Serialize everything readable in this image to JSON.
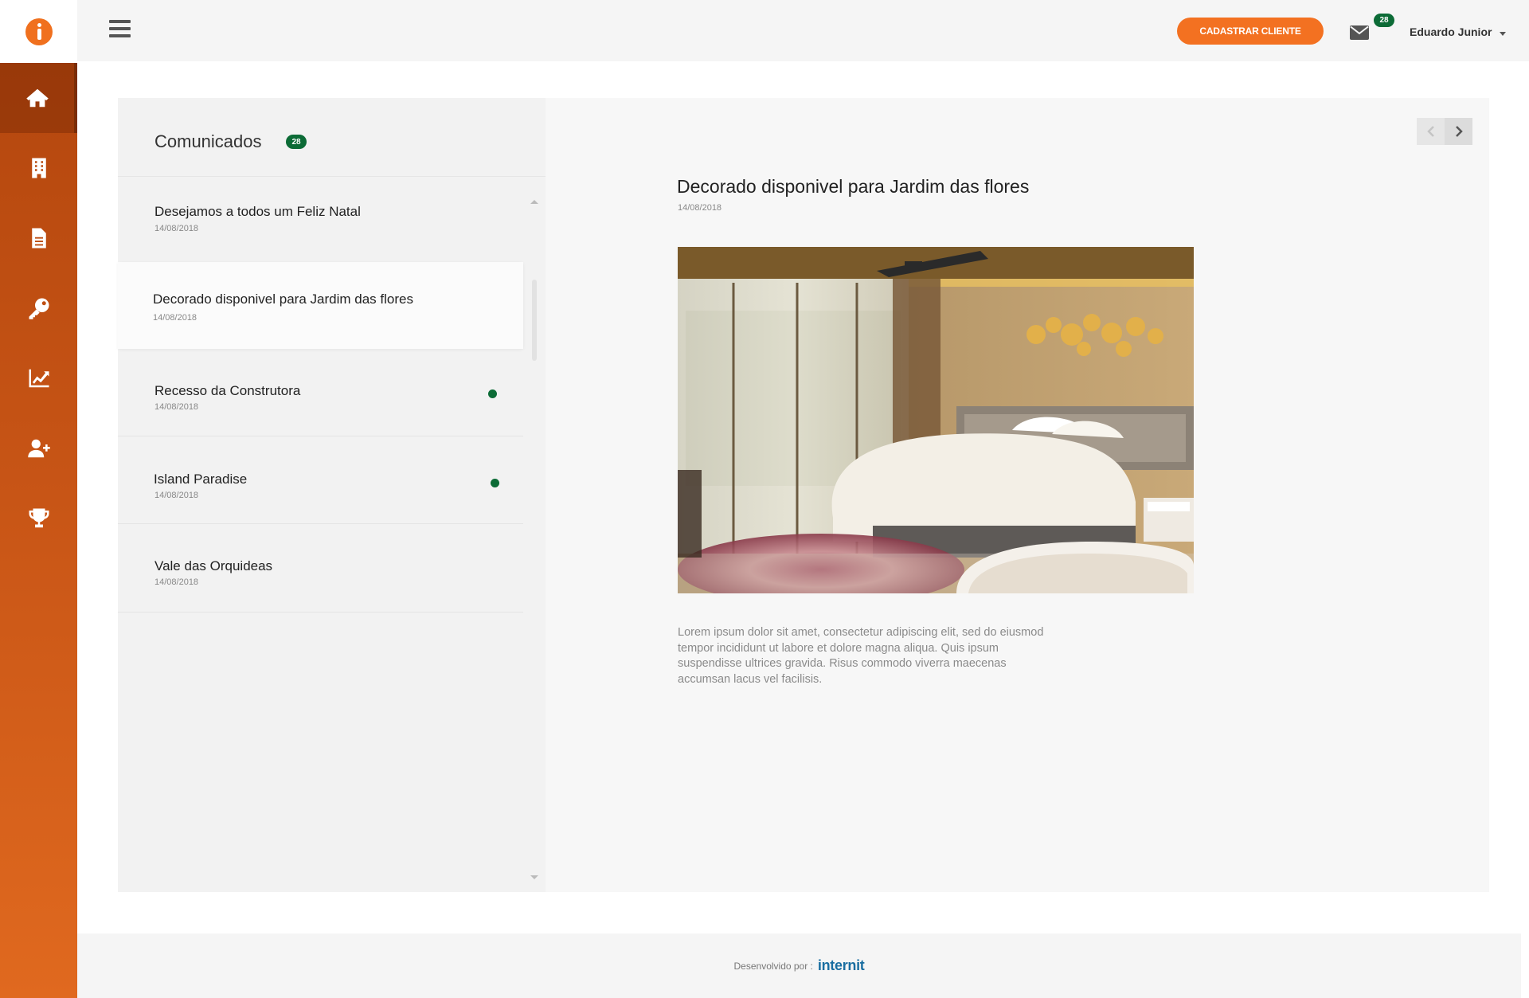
{
  "sidebar": {
    "logo_icon": "info-logo-icon",
    "items": [
      {
        "icon": "home-icon",
        "active": true
      },
      {
        "icon": "building-icon",
        "active": false
      },
      {
        "icon": "document-icon",
        "active": false
      },
      {
        "icon": "key-icon",
        "active": false
      },
      {
        "icon": "chart-line-icon",
        "active": false
      },
      {
        "icon": "user-plus-icon",
        "active": false
      },
      {
        "icon": "trophy-icon",
        "active": false
      }
    ]
  },
  "header": {
    "menu_icon": "hamburger-icon",
    "cta_label": "CADASTRAR CLIENTE",
    "mail_badge": "28",
    "user_name": "Eduardo Junior"
  },
  "announcements": {
    "title": "Comunicados",
    "count": "28",
    "items": [
      {
        "title": "Desejamos a todos um Feliz Natal",
        "date": "14/08/2018",
        "unread": false,
        "selected": false
      },
      {
        "title": "Decorado disponivel para Jardim das flores",
        "date": "14/08/2018",
        "unread": false,
        "selected": true
      },
      {
        "title": "Recesso da Construtora",
        "date": "14/08/2018",
        "unread": true,
        "selected": false
      },
      {
        "title": "Island Paradise",
        "date": "14/08/2018",
        "unread": true,
        "selected": false
      },
      {
        "title": "Vale das Orquideas",
        "date": "14/08/2018",
        "unread": false,
        "selected": false
      }
    ]
  },
  "detail": {
    "title": "Decorado disponivel para Jardim das flores",
    "date": "14/08/2018",
    "body": "Lorem ipsum dolor sit amet, consectetur adipiscing elit, sed do eiusmod tempor incididunt ut labore et dolore magna aliqua. Quis ipsum suspendisse ultrices gravida. Risus commodo viverra maecenas accumsan lacus vel facilisis."
  },
  "footer": {
    "label": "Desenvolvido por :",
    "brand": "internit"
  },
  "colors": {
    "accent": "#f37121",
    "badge": "#0c6b36",
    "brand_link": "#1a6ea1"
  }
}
